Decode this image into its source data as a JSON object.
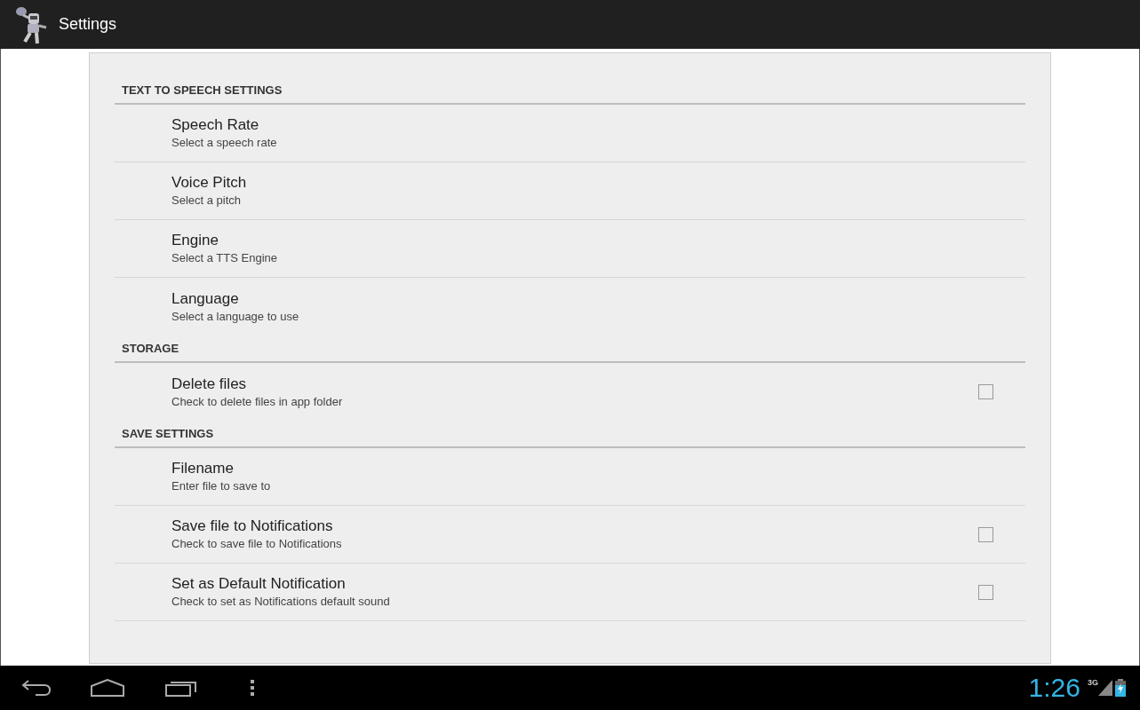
{
  "action_bar": {
    "title": "Settings"
  },
  "sections": [
    {
      "title": "TEXT TO SPEECH SETTINGS",
      "items": [
        {
          "kind": "plain",
          "title": "Speech Rate",
          "summary": "Select a speech rate"
        },
        {
          "kind": "plain",
          "title": "Voice Pitch",
          "summary": "Select a pitch"
        },
        {
          "kind": "plain",
          "title": "Engine",
          "summary": "Select a TTS Engine"
        },
        {
          "kind": "plain",
          "title": "Language",
          "summary": "Select a language to use"
        }
      ]
    },
    {
      "title": "STORAGE",
      "items": [
        {
          "kind": "checkbox",
          "title": "Delete files",
          "summary": "Check to delete files in app folder",
          "checked": false
        }
      ]
    },
    {
      "title": "SAVE SETTINGS",
      "items": [
        {
          "kind": "plain",
          "title": "Filename",
          "summary": "Enter file to save to"
        },
        {
          "kind": "checkbox",
          "title": "Save file to Notifications",
          "summary": "Check to save file to Notifications",
          "checked": false
        },
        {
          "kind": "checkbox",
          "title": "Set as Default Notification",
          "summary": "Check to set as Notifications default sound",
          "checked": false
        }
      ]
    }
  ],
  "system_bar": {
    "clock": "1:26",
    "network": "3G"
  }
}
